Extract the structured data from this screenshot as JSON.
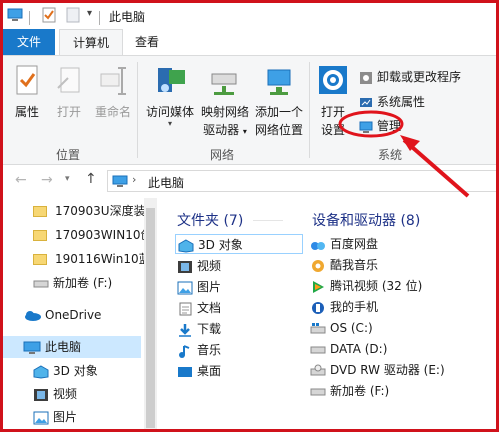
{
  "title_bar": {
    "title": "此电脑",
    "quick_access_arrow": "▾"
  },
  "ribbon_tabs": {
    "file": "文件",
    "computer": "计算机",
    "view": "查看"
  },
  "ribbon": {
    "groups": {
      "location": {
        "label": "位置",
        "buttons": {
          "properties": "属性",
          "open": "打开",
          "rename": "重命名"
        }
      },
      "network": {
        "label": "网络",
        "buttons": {
          "access_media": "访问媒体",
          "map_drive_line1": "映射网络",
          "map_drive_line2": "驱动器",
          "add_location_line1": "添加一个",
          "add_location_line2": "网络位置"
        }
      },
      "system": {
        "label": "系统",
        "buttons": {
          "open_settings_line1": "打开",
          "open_settings_line2": "设置",
          "uninstall": "卸载或更改程序",
          "system_properties": "系统属性",
          "manage": "管理"
        }
      }
    }
  },
  "address_bar": {
    "path": "此电脑"
  },
  "nav_pane": {
    "items": [
      {
        "label": "170903U深度装"
      },
      {
        "label": "170903WIN10创"
      },
      {
        "label": "190116Win10蓝"
      },
      {
        "label": "新加卷 (F:)"
      },
      {
        "label": "OneDrive"
      },
      {
        "label": "此电脑"
      },
      {
        "label": "3D 对象"
      },
      {
        "label": "视频"
      },
      {
        "label": "图片"
      }
    ]
  },
  "content": {
    "folders_heading": "文件夹 (7)",
    "folders": [
      {
        "label": "3D 对象"
      },
      {
        "label": "视频"
      },
      {
        "label": "图片"
      },
      {
        "label": "文档"
      },
      {
        "label": "下载"
      },
      {
        "label": "音乐"
      },
      {
        "label": "桌面"
      }
    ],
    "devices_heading": "设备和驱动器 (8)",
    "devices": [
      {
        "label": "百度网盘"
      },
      {
        "label": "酷我音乐"
      },
      {
        "label": "腾讯视频 (32 位)"
      },
      {
        "label": "我的手机"
      },
      {
        "label": "OS (C:)"
      },
      {
        "label": "DATA (D:)"
      },
      {
        "label": "DVD RW 驱动器 (E:)"
      },
      {
        "label": "新加卷 (F:)"
      }
    ]
  },
  "colors": {
    "accent": "#1979ca",
    "annotation": "#e0141c",
    "heading": "#1e3287"
  }
}
